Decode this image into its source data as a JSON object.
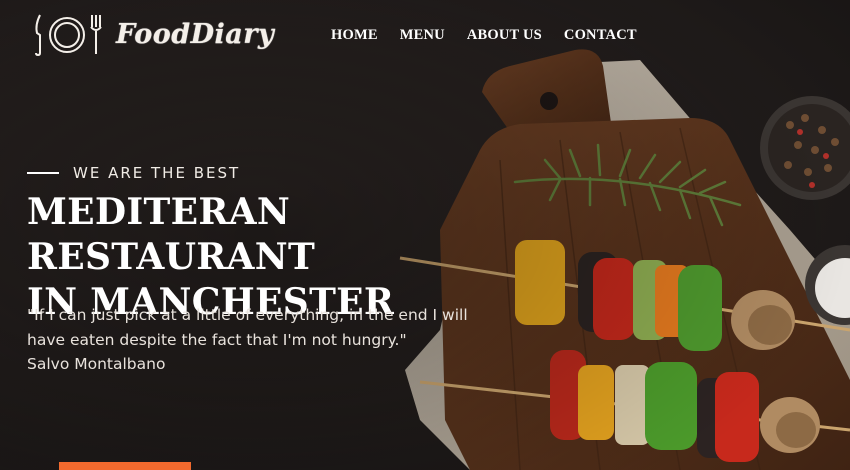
{
  "brand": {
    "name": "FoodDiary"
  },
  "nav": {
    "items": [
      {
        "label": "HOME"
      },
      {
        "label": "MENU"
      },
      {
        "label": "ABOUT US"
      },
      {
        "label": "CONTACT"
      }
    ]
  },
  "hero": {
    "eyebrow": "WE ARE THE BEST",
    "headline_line1": "MEDITERAN RESTAURANT",
    "headline_line2": "IN MANCHESTER",
    "quote_line1": "\"If I can just pick at a little of everything, in the end I will",
    "quote_line2": "have eaten despite the fact that I'm not hungry.\"",
    "author": "Salvo Montalbano"
  },
  "colors": {
    "background": "#211c1b",
    "accent": "#f26a2e",
    "text": "#ffffff"
  },
  "icons": {
    "logo": "plate-fork-knife-icon"
  }
}
